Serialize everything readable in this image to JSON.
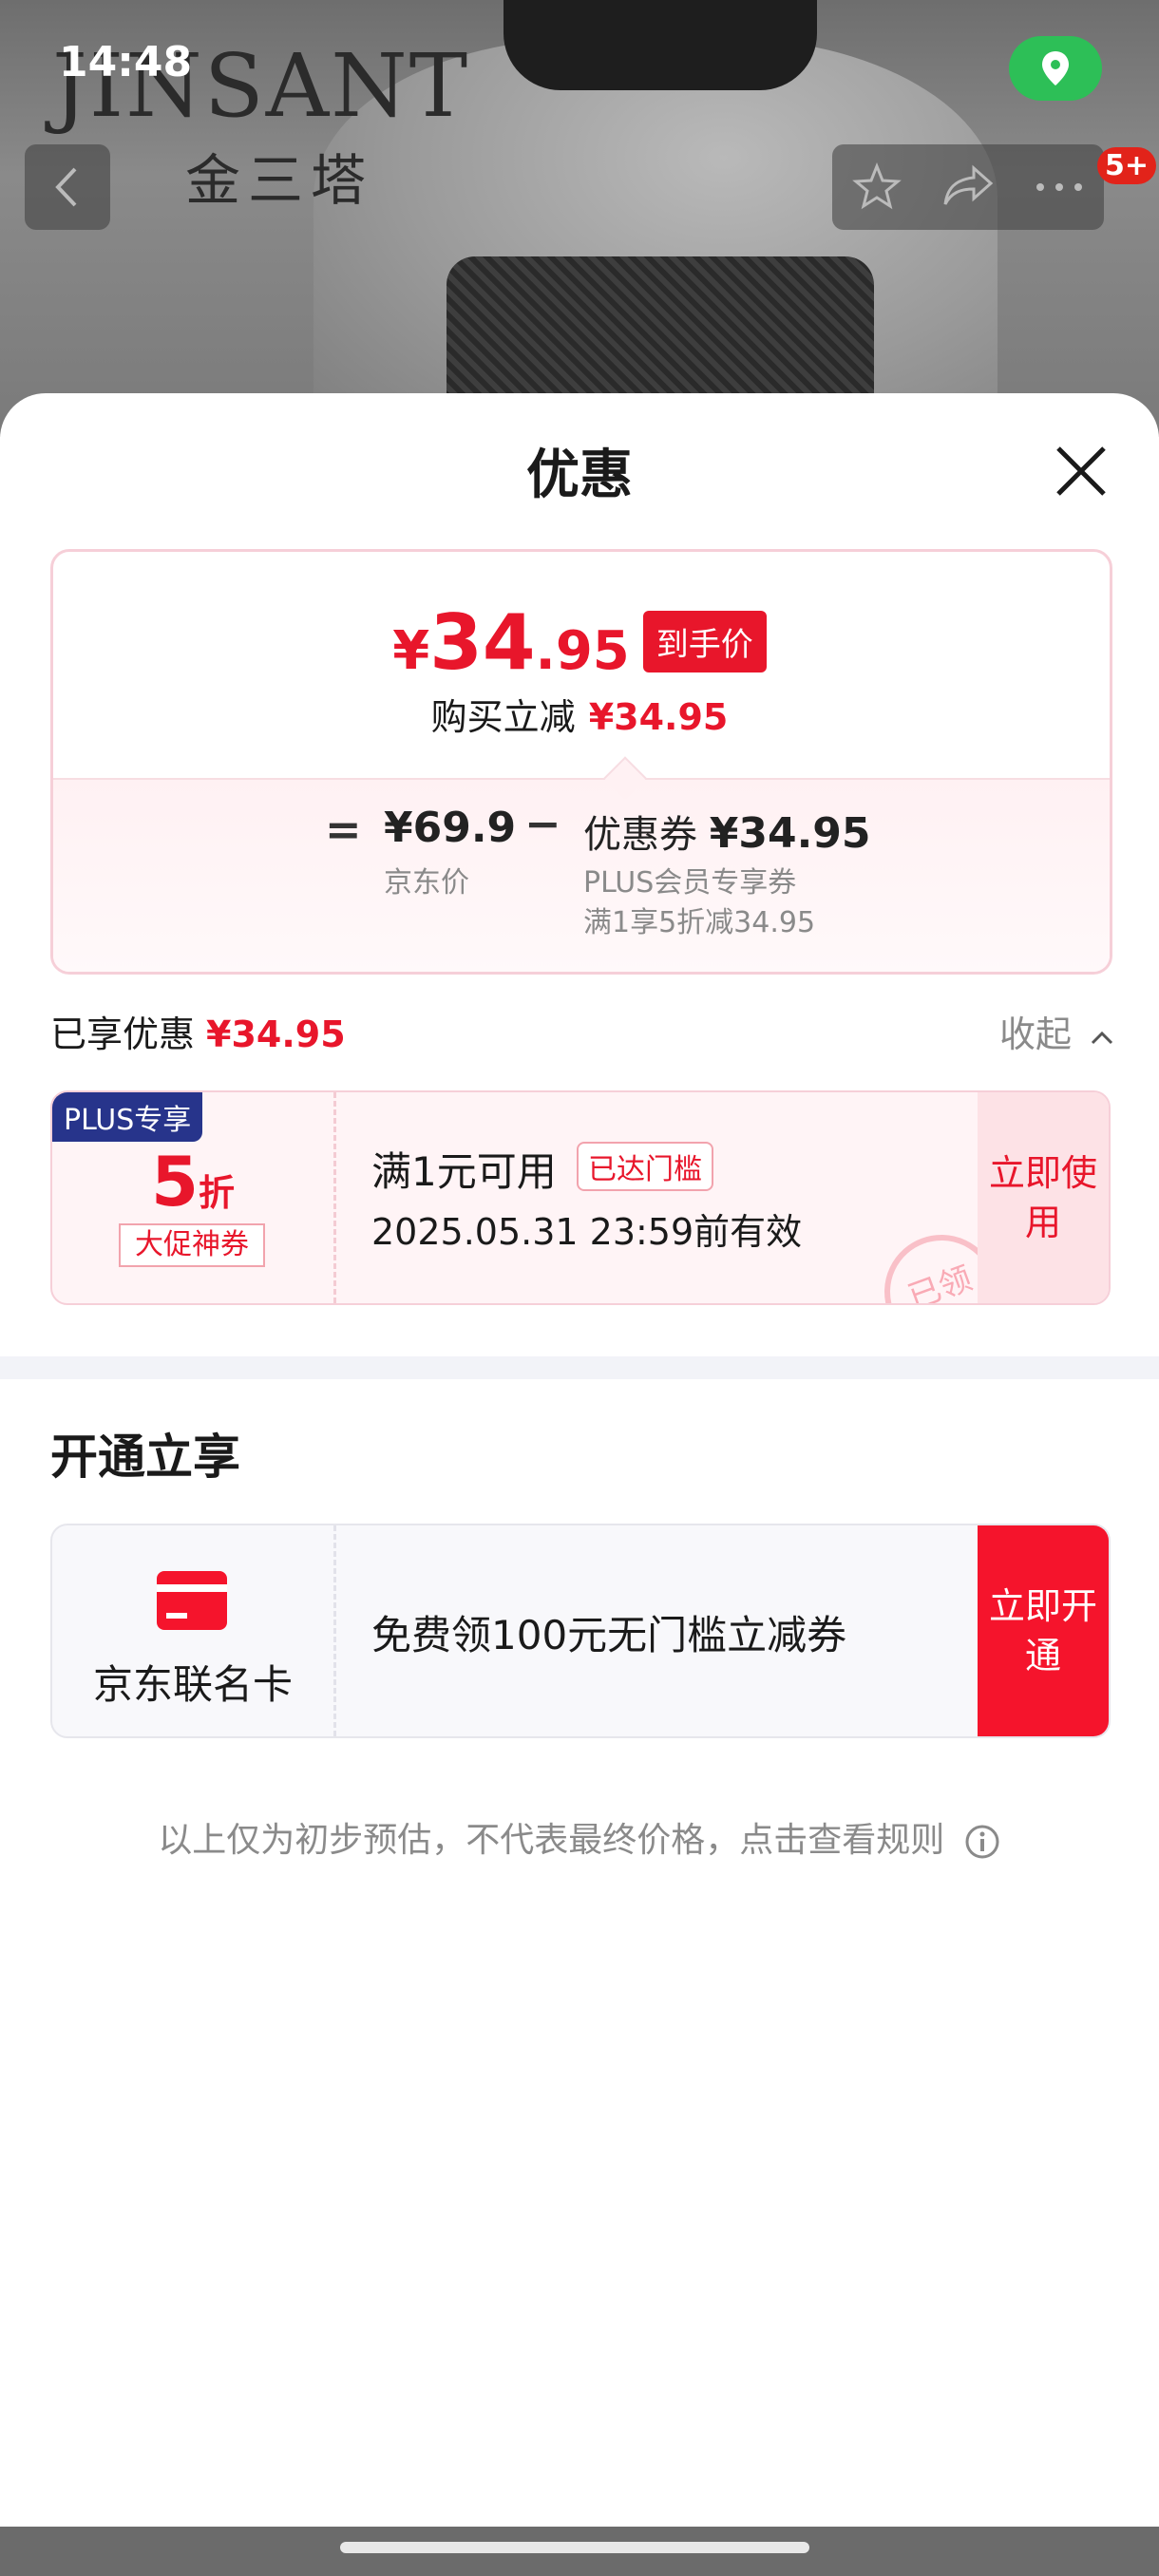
{
  "status_bar": {
    "time": "14:48"
  },
  "brand": {
    "en": "JINSANT",
    "cn": "金三塔"
  },
  "nav": {
    "badge": "5+"
  },
  "sheet": {
    "title": "优惠"
  },
  "price": {
    "yen": "¥",
    "int": "34",
    "dec": ".95",
    "tag": "到手价",
    "reduce_label": "购买立减",
    "reduce_amount": "¥34.95",
    "equals": "=",
    "jd_price": "¥69.9",
    "jd_label": "京东价",
    "minus": "−",
    "coupon_label": "优惠券",
    "coupon_amount": "¥34.95",
    "coupon_sub1": "PLUS会员专享券",
    "coupon_sub2": "满1享5折减34.95"
  },
  "enjoyed": {
    "label": "已享优惠",
    "amount": "¥34.95",
    "collapse": "收起"
  },
  "coupon": {
    "plus_tag": "PLUS专享",
    "discount_num": "5",
    "discount_unit": "折",
    "promo_tag": "大促神券",
    "condition": "满1元可用",
    "reached": "已达门槛",
    "valid": "2025.05.31 23:59前有效",
    "use_button": "立即使用",
    "stamp": "已领"
  },
  "open_section": {
    "title": "开通立享",
    "card_name": "京东联名卡",
    "card_desc": "免费领100元无门槛立减券",
    "open_button": "立即开通"
  },
  "note": "以上仅为初步预估，不代表最终价格，点击查看规则"
}
